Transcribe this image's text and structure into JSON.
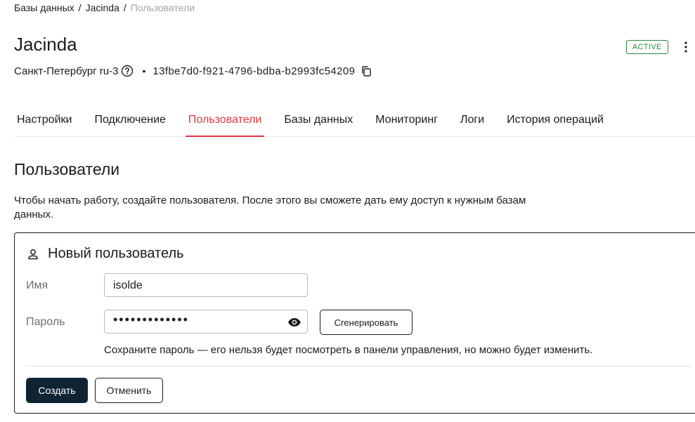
{
  "breadcrumb": {
    "items": [
      "Базы данных",
      "Jacinda"
    ],
    "separator": "/",
    "current": "Пользователи"
  },
  "header": {
    "title": "Jacinda",
    "status": "ACTIVE",
    "region": "Санкт-Петербург ru-3",
    "bullet": "•",
    "uuid": "13fbe7d0-f921-4796-bdba-b2993fc54209"
  },
  "tabs": [
    {
      "label": "Настройки",
      "active": false
    },
    {
      "label": "Подключение",
      "active": false
    },
    {
      "label": "Пользователи",
      "active": true
    },
    {
      "label": "Базы данных",
      "active": false
    },
    {
      "label": "Мониторинг",
      "active": false
    },
    {
      "label": "Логи",
      "active": false
    },
    {
      "label": "История операций",
      "active": false
    }
  ],
  "section": {
    "title": "Пользователи",
    "intro": "Чтобы начать работу, создайте пользователя. После этого вы сможете дать ему доступ к нужным базам данных."
  },
  "form": {
    "title": "Новый пользователь",
    "name_label": "Имя",
    "name_value": "isolde",
    "password_label": "Пароль",
    "password_value": "•••••••••••••",
    "generate_label": "Сгенерировать",
    "hint": "Сохраните пароль — его нельзя будет посмотреть в панели управления, но можно будет изменить.",
    "create_label": "Создать",
    "cancel_label": "Отменить"
  },
  "colors": {
    "accent": "#e0393e",
    "status": "#2a8a3e",
    "primary_button": "#0f2433"
  },
  "icons": [
    "more-vertical-icon",
    "help-icon",
    "copy-icon",
    "user-icon",
    "eye-icon"
  ]
}
